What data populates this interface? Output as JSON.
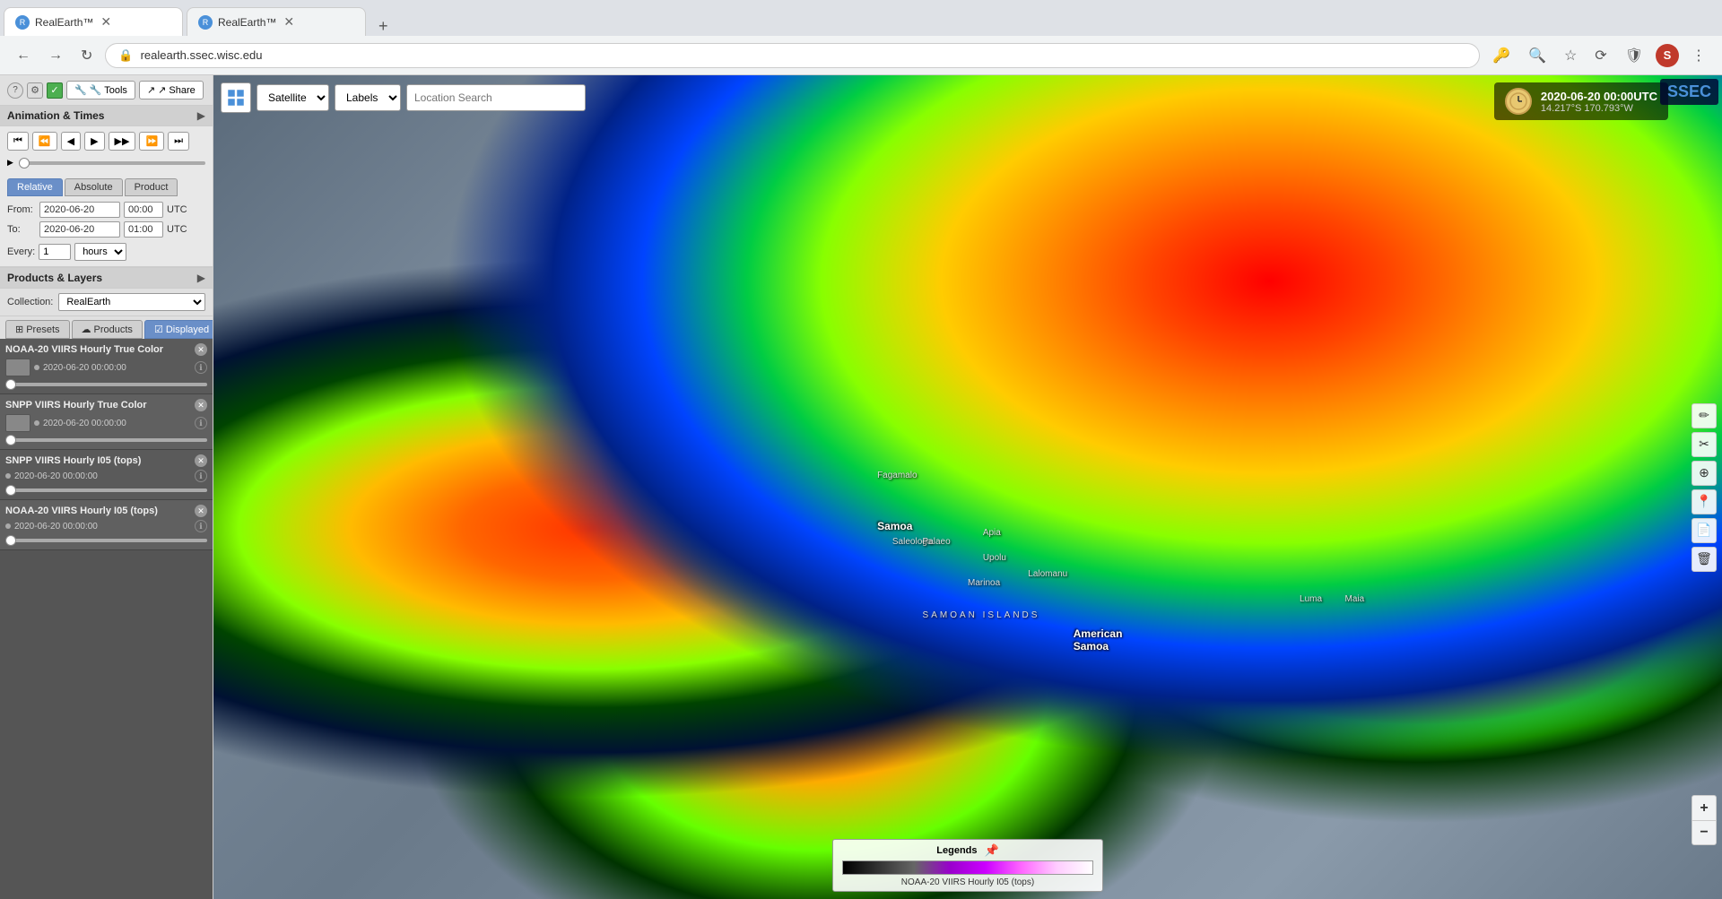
{
  "browser": {
    "tabs": [
      {
        "id": "tab1",
        "label": "RealEarth™",
        "active": true
      },
      {
        "id": "tab2",
        "label": "RealEarth™",
        "active": false
      }
    ],
    "url": "realearth.ssec.wisc.edu"
  },
  "sidebar": {
    "toolbar": {
      "question_label": "?",
      "settings_label": "⚙",
      "checkbox_label": "✓",
      "tools_label": "🔧 Tools",
      "share_label": "↗ Share"
    },
    "animation_panel": {
      "title": "Animation & Times",
      "time_tabs": [
        {
          "label": "Relative",
          "active": true
        },
        {
          "label": "Absolute",
          "active": false
        },
        {
          "label": "Product",
          "active": false
        }
      ],
      "from_date": "2020-06-20",
      "from_time": "00:00",
      "to_date": "2020-06-20",
      "to_time": "01:00",
      "utc_label": "UTC",
      "every_label": "Every:",
      "every_value": "1",
      "hours_label": "hours"
    },
    "products_panel": {
      "title": "Products & Layers",
      "collection_label": "Collection:",
      "collection_value": "RealEarth",
      "layer_tabs": [
        {
          "label": "⊞ Presets",
          "active": false
        },
        {
          "label": "☁ Products",
          "active": false
        },
        {
          "label": "☑ Displayed",
          "active": true
        }
      ],
      "layers": [
        {
          "name": "NOAA-20 VIIRS Hourly True Color",
          "timestamp": "2020-06-20 00:00:00",
          "has_thumbnail": true
        },
        {
          "name": "SNPP VIIRS Hourly True Color",
          "timestamp": "2020-06-20 00:00:00",
          "has_thumbnail": true
        },
        {
          "name": "SNPP VIIRS Hourly I05 (tops)",
          "timestamp": "2020-06-20 00:00:00",
          "has_thumbnail": false
        },
        {
          "name": "NOAA-20 VIIRS Hourly I05 (tops)",
          "timestamp": "2020-06-20 00:00:00",
          "has_thumbnail": false
        }
      ]
    }
  },
  "map": {
    "time_display": "2020-06-20 00:00UTC",
    "coords_display": "14.217°S 170.793°W",
    "satellite_option": "Satellite",
    "labels_option": "Labels",
    "search_placeholder": "Location Search",
    "place_labels": [
      {
        "name": "Samoa",
        "top": "54%",
        "left": "44%"
      },
      {
        "name": "American Samoa",
        "top": "67%",
        "left": "57%"
      },
      {
        "name": "Fagamalo",
        "top": "48%",
        "left": "44%"
      },
      {
        "name": "Saleologa",
        "top": "56%",
        "left": "45%"
      },
      {
        "name": "Apia",
        "top": "56%",
        "left": "51%"
      },
      {
        "name": "Upolu",
        "top": "58%",
        "left": "51%"
      },
      {
        "name": "Palaeo",
        "top": "57%",
        "left": "47%"
      },
      {
        "name": "Lalomanu",
        "top": "60%",
        "left": "54%"
      },
      {
        "name": "Marinoa",
        "top": "61%",
        "left": "50%"
      },
      {
        "name": "SAMOAN ISLANDS",
        "top": "65%",
        "left": "47%"
      },
      {
        "name": "Luma",
        "top": "63%",
        "left": "72%"
      },
      {
        "name": "Maia",
        "top": "63%",
        "left": "75%"
      }
    ]
  },
  "legend": {
    "label_btn": "Legends",
    "pin_symbol": "📌",
    "legend_title": "NOAA-20 VIIRS Hourly I05 (tops)"
  },
  "right_toolbar": {
    "buttons": [
      "✏",
      "✂",
      "⊕",
      "📍",
      "📄",
      "🗑"
    ]
  },
  "zoom": {
    "plus": "+",
    "minus": "−"
  },
  "ssec": {
    "logo": "SSEC"
  }
}
